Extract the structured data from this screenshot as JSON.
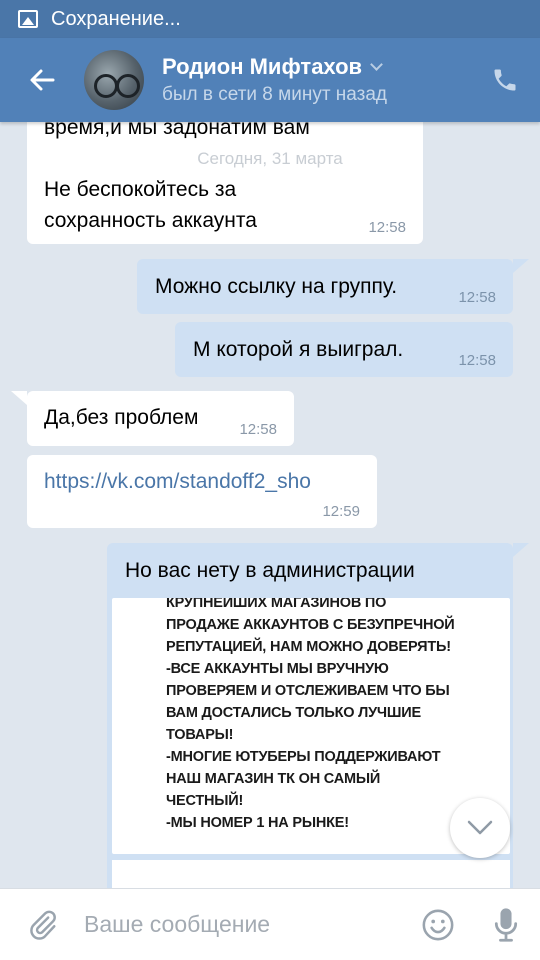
{
  "status_bar": {
    "text": "Сохранение...",
    "icon": "image-icon"
  },
  "header": {
    "name": "Родион Мифтахов",
    "status": "был в сети 8 минут назад",
    "back_icon": "arrow-left-icon",
    "call_icon": "phone-icon"
  },
  "date_separator": "Сегодня, 31 марта",
  "messages": [
    {
      "dir": "in",
      "lines": [
        "время,и мы задонатим вам",
        "",
        "Не беспокойтесь за",
        "сохранность аккаунта"
      ],
      "time": "12:58"
    },
    {
      "dir": "out",
      "text": "Можно ссылку на группу.",
      "time": "12:58"
    },
    {
      "dir": "out",
      "text": "М которой я выиграл.",
      "time": "12:58"
    },
    {
      "dir": "in",
      "text": "Да,без проблем",
      "time": "12:58"
    },
    {
      "dir": "in",
      "text": "https://vk.com/standoff2_sho",
      "time": "12:59",
      "is_link": true
    },
    {
      "dir": "out",
      "text": "Но вас нету в администрации"
    }
  ],
  "attached_screenshot_text": "КРУПНЕЙШИХ МАГАЗИНОВ ПО\nПРОДАЖЕ АККАУНТОВ С БЕЗУПРЕЧНОЙ\nРЕПУТАЦИЕЙ, НАМ МОЖНО ДОВЕРЯТЬ!\n-ВСЕ АККАУНТЫ МЫ ВРУЧНУЮ\nПРОВЕРЯЕМ И ОТСЛЕЖИВАЕМ ЧТО БЫ\nВАМ ДОСТАЛИСЬ ТОЛЬКО ЛУЧШИЕ\nТОВАРЫ!\n-МНОГИЕ ЮТУБЕРЫ ПОДДЕРЖИВАЮТ\nНАШ МАГАЗИН ТК ОН САМЫЙ\nЧЕСТНЫЙ!\n-МЫ НОМЕР 1 НА РЫНКЕ!",
  "input": {
    "placeholder": "Ваше сообщение"
  },
  "colors": {
    "header": "#5181b8",
    "status_bar": "#4a76a8",
    "chat_bg": "#dfe6ee",
    "outgoing": "#cfe0f3",
    "incoming": "#ffffff",
    "link": "#4a76a8"
  }
}
